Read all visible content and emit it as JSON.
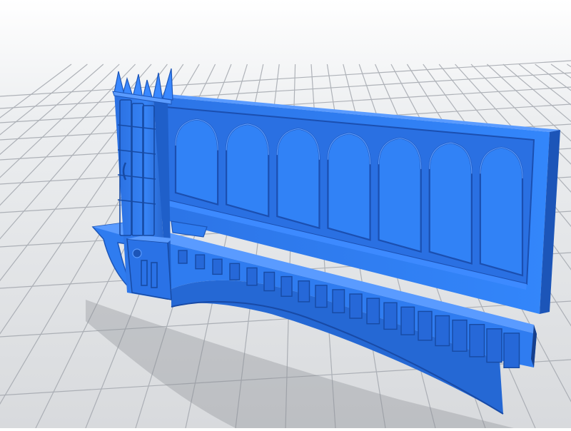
{
  "scene": {
    "subject": "3d-printable-gothic-wall-model",
    "colors": {
      "model": "#2f7cf0",
      "model_dark": "#1c55b8",
      "model_shadow": "#163f8c",
      "model_light": "#5a9bff",
      "floor": "#e3e5e8",
      "grid": "#9a9ea5",
      "shadow": "#7d8087",
      "sky": "#ffffff"
    }
  }
}
